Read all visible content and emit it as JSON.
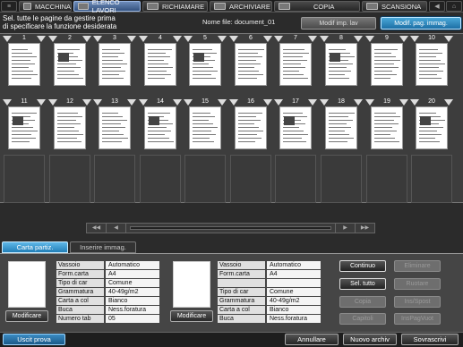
{
  "tabs": [
    {
      "label": "MACCHINA",
      "icon": "machine-icon"
    },
    {
      "label": "ELENCO LAVORI",
      "icon": "job-list-icon"
    },
    {
      "label": "RICHIAMARE",
      "icon": "recall-icon"
    },
    {
      "label": "ARCHIVIARE",
      "icon": "store-icon"
    },
    {
      "label": "COPIA",
      "icon": "copy-icon"
    },
    {
      "label": "SCANSIONA",
      "icon": "scan-icon"
    }
  ],
  "header": {
    "message": "Sel. tutte le pagine da gestire prima\n di specificare la funzione desiderata",
    "file_name": "Nome file: document_01",
    "modif_imp_lav": "Modif imp. lav",
    "modif_pag_immag": "Modif. pag. immag."
  },
  "pages": [
    "1",
    "2",
    "3",
    "4",
    "5",
    "6",
    "7",
    "8",
    "9",
    "10",
    "11",
    "12",
    "13",
    "14",
    "15",
    "16",
    "17",
    "18",
    "19",
    "20"
  ],
  "lower_tabs": {
    "carta_partiz": "Carta partiz.",
    "inserire_immag": "Inserire immag."
  },
  "left_paper": {
    "modify_label": "Modificare",
    "rows": [
      {
        "label": "Vassoio",
        "value": "Automatico"
      },
      {
        "label": "Form.carta",
        "value": "A4"
      },
      {
        "label": "Tipo di car",
        "value": "Comune"
      },
      {
        "label": "Grammatura",
        "value": "40-49g/m2"
      },
      {
        "label": "Carta a col",
        "value": "Bianco"
      },
      {
        "label": "Buca",
        "value": "Ness.foratura"
      },
      {
        "label": "Numero tab",
        "value": "05"
      }
    ]
  },
  "right_paper": {
    "modify_label": "Modificare",
    "rows": [
      {
        "label": "Vassoio",
        "value": "Automatico"
      },
      {
        "label": "Form.carta",
        "value": "A4"
      },
      {
        "label": "",
        "value": ""
      },
      {
        "label": "Tipo di car",
        "value": "Comune"
      },
      {
        "label": "Grammatura",
        "value": "40-49g/m2"
      },
      {
        "label": "Carta a col",
        "value": "Bianco"
      },
      {
        "label": "Buca",
        "value": "Ness.foratura"
      }
    ]
  },
  "actions": {
    "continuo": "Continuo",
    "eliminare": "Eliminare",
    "sel_tutto": "Sel. tutto",
    "ruotare": "Ruotare",
    "copia": "Copia",
    "ins_spost": "Ins/Spost",
    "capitoli": "Capitoli",
    "ins_pag_vuot": "InsPagVuot"
  },
  "bottom": {
    "uscit_prova": "Uscit prova",
    "annullare": "Annullare",
    "nuovo_archiv": "Nuovo archiv",
    "sovrascrivi": "Sovrascrivi"
  },
  "colors": {
    "accent": "#227fb8",
    "active_tab": "#34527f"
  }
}
